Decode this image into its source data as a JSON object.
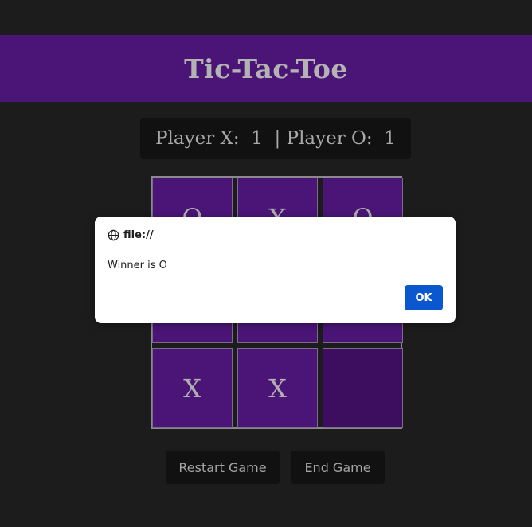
{
  "header": {
    "title": "Tic-Tac-Toe"
  },
  "scoreboard": {
    "text": "Player X:  1  | Player O:  1",
    "player_x_score": 1,
    "player_o_score": 1
  },
  "board": {
    "cells": [
      "O",
      "X",
      "O",
      "",
      "",
      "",
      "X",
      "X",
      ""
    ]
  },
  "buttons": {
    "restart_label": "Restart Game",
    "end_label": "End Game"
  },
  "dialog": {
    "origin": "file://",
    "message": "Winner is O",
    "ok_label": "OK"
  },
  "colors": {
    "header_bg": "#4b1577",
    "cell_bg": "#4a1577",
    "dialog_button": "#0b57d0"
  }
}
